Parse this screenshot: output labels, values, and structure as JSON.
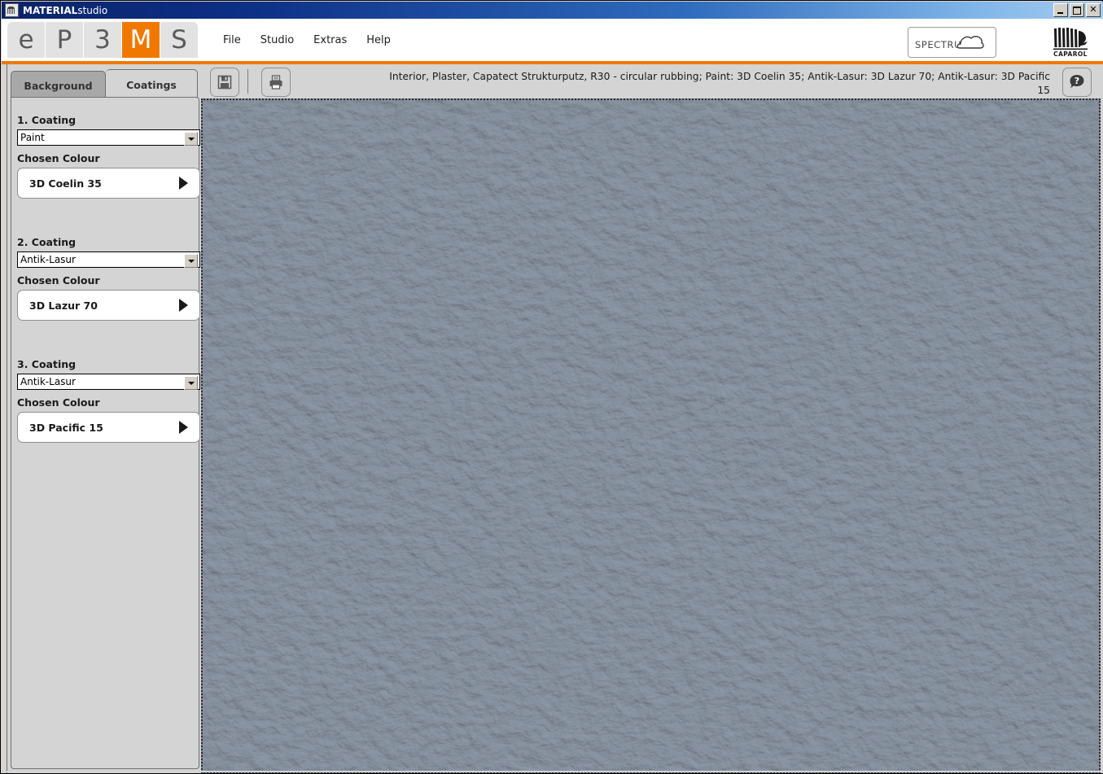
{
  "window": {
    "title_bold": "MATERIAL",
    "title_regular": "studio",
    "icon": "app-icon",
    "controls": {
      "minimize": "minimize-button",
      "maximize": "maximize-button",
      "close": "✕"
    }
  },
  "header": {
    "logo_tiles": [
      {
        "letter": "e",
        "active": false
      },
      {
        "letter": "P",
        "active": false
      },
      {
        "letter": "3",
        "active": false
      },
      {
        "letter": "M",
        "active": true
      },
      {
        "letter": "S",
        "active": false
      }
    ],
    "menu": [
      "File",
      "Studio",
      "Extras",
      "Help"
    ],
    "spectrum_label": "SPECTRUM",
    "caparol_label": "CAPAROL",
    "accent_color": "#f07800"
  },
  "sidebar": {
    "tabs": [
      {
        "label": "Background",
        "active": false
      },
      {
        "label": "Coatings",
        "active": true
      }
    ],
    "chosen_colour_label": "Chosen Colour",
    "coatings": [
      {
        "heading": "1. Coating",
        "type": "Paint",
        "colour_label": "Chosen Colour",
        "colour": "3D Coelin 35"
      },
      {
        "heading": "2. Coating",
        "type": "Antik-Lasur",
        "colour_label": "Chosen Colour",
        "colour": "3D Lazur 70"
      },
      {
        "heading": "3. Coating",
        "type": "Antik-Lasur",
        "colour_label": "Chosen Colour",
        "colour": "3D Pacific 15"
      }
    ]
  },
  "toolbar": {
    "save_icon": "floppy-disk-icon",
    "print_icon": "printer-icon",
    "help_icon": "speech-bubble-question-icon",
    "status_text": "Interior, Plaster, Capatect Strukturputz, R30 - circular rubbing; Paint: 3D Coelin 35; Antik-Lasur: 3D Lazur 70; Antik-Lasur: 3D Pacific 15"
  },
  "canvas": {
    "material": "Capatect Strukturputz R30 plaster texture",
    "base_color": "#7b8795"
  }
}
